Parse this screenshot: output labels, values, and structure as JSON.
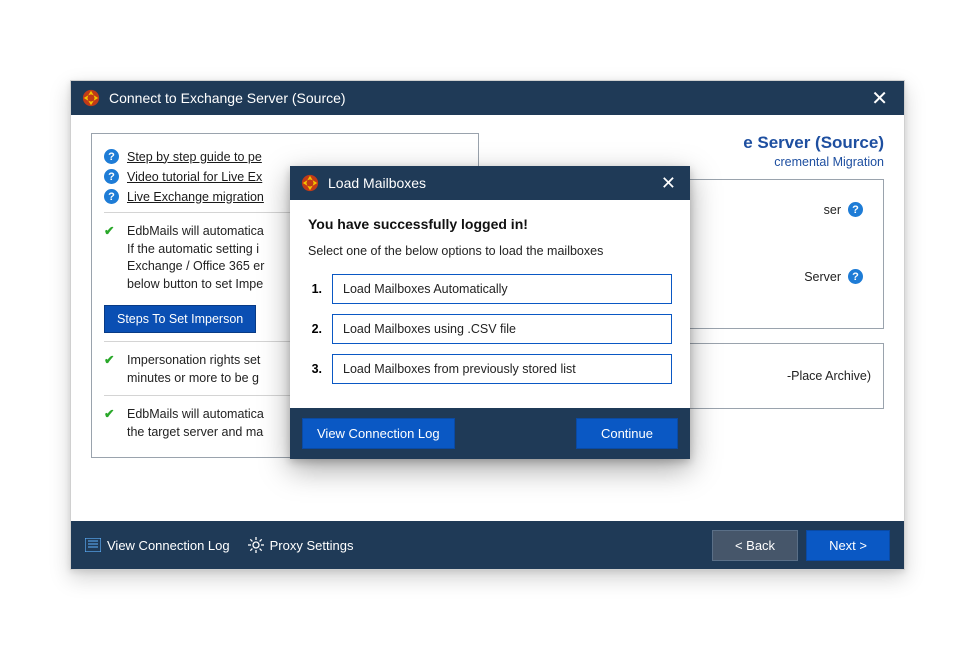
{
  "main": {
    "title": "Connect to Exchange Server (Source)"
  },
  "left": {
    "links": {
      "guide": "Step by step guide to pe",
      "video": "Video tutorial for Live Ex",
      "faq": "Live Exchange migration"
    },
    "info1_line1": "EdbMails will automatica",
    "info1_line2": "If the automatic setting i",
    "info1_line3": "Exchange / Office 365 er",
    "info1_line4": "below button to set Impe",
    "steps_btn": "Steps To Set Imperson",
    "info2_line1": "Impersonation rights set",
    "info2_line2": "minutes or more to be g",
    "info3_line1": "EdbMails will automatica",
    "info3_line2": "the target server and ma"
  },
  "right": {
    "heading_suffix": "e Server (Source)",
    "sub_suffix": "cremental Migration",
    "radio1_suffix": "ser",
    "radio2_suffix": "Server",
    "archive_suffix": "-Place Archive)"
  },
  "footer": {
    "view_log": "View Connection Log",
    "proxy": "Proxy Settings",
    "back": "< Back",
    "next": "Next >"
  },
  "modal": {
    "title": "Load Mailboxes",
    "heading": "You have successfully logged in!",
    "sub": "Select one of the below options to load the mailboxes",
    "opt1_num": "1.",
    "opt1": "Load Mailboxes Automatically",
    "opt2_num": "2.",
    "opt2": "Load Mailboxes using .CSV file",
    "opt3_num": "3.",
    "opt3": "Load Mailboxes from previously stored list",
    "view_log": "View Connection Log",
    "continue": "Continue"
  }
}
